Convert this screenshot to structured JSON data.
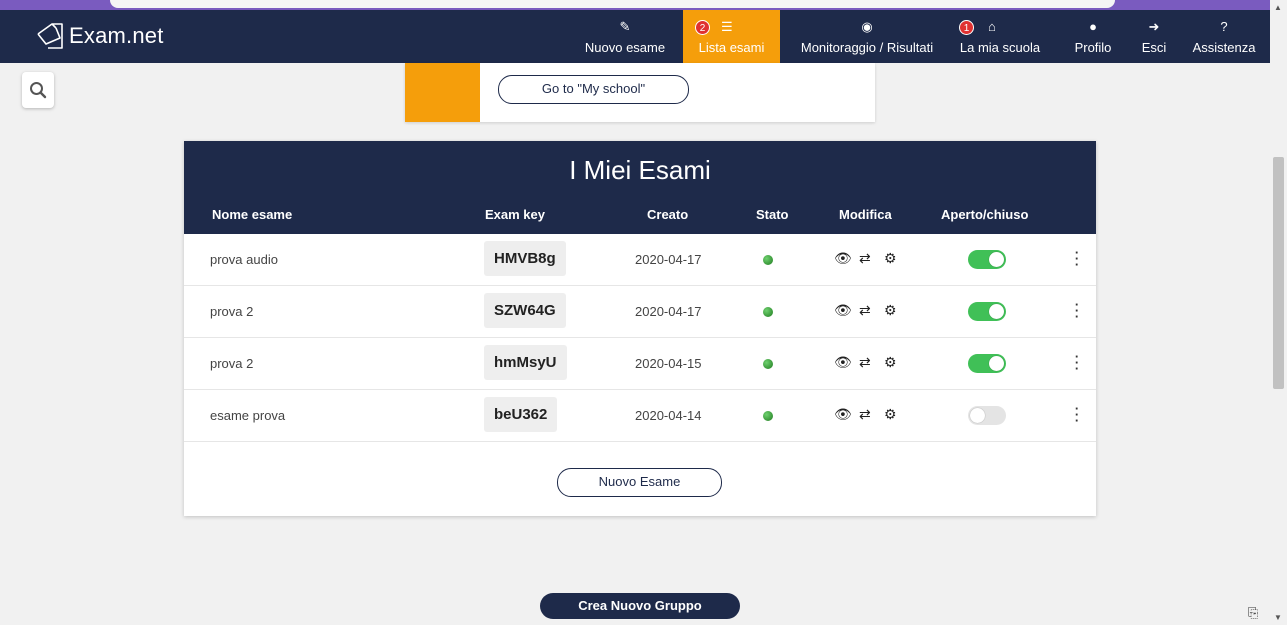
{
  "navbar": {
    "brand": "Exam.net",
    "items": [
      {
        "label": "Nuovo esame",
        "icon": "pencil-icon",
        "glyph": "✎",
        "active": false
      },
      {
        "label": "Lista esami",
        "icon": "list-icon",
        "glyph": "☰",
        "active": true,
        "badge": "2"
      },
      {
        "label": "Monitoraggio / Risultati",
        "icon": "eye-icon",
        "glyph": "👁",
        "active": false
      },
      {
        "label": "La mia scuola",
        "icon": "home-icon",
        "glyph": "⌂",
        "active": false,
        "badge": "1"
      },
      {
        "label": "Profilo",
        "icon": "user-icon",
        "glyph": "●",
        "active": false
      },
      {
        "label": "Esci",
        "icon": "logout-icon",
        "glyph": "➜",
        "active": false
      },
      {
        "label": "Assistenza",
        "icon": "help-icon",
        "glyph": "?",
        "active": false
      }
    ]
  },
  "banner": {
    "button_label": "Go to \"My school\""
  },
  "exams": {
    "title": "I Miei Esami",
    "columns": {
      "name": "Nome esame",
      "key": "Exam key",
      "created": "Creato",
      "status": "Stato",
      "edit": "Modifica",
      "open": "Aperto/chiuso"
    },
    "rows": [
      {
        "name": "prova audio",
        "key": "HMVB8g",
        "created": "2020-04-17",
        "open": true
      },
      {
        "name": "prova 2",
        "key": "SZW64G",
        "created": "2020-04-17",
        "open": true
      },
      {
        "name": "prova 2",
        "key": "hmMsyU",
        "created": "2020-04-15",
        "open": true
      },
      {
        "name": "esame prova",
        "key": "beU362",
        "created": "2020-04-14",
        "open": false
      }
    ],
    "new_exam_label": "Nuovo Esame"
  },
  "new_group_label": "Crea Nuovo Gruppo",
  "colors": {
    "navy": "#1e2a4a",
    "accent": "#f59e0b",
    "toggle_on": "#40c057",
    "badge": "#e03131"
  }
}
